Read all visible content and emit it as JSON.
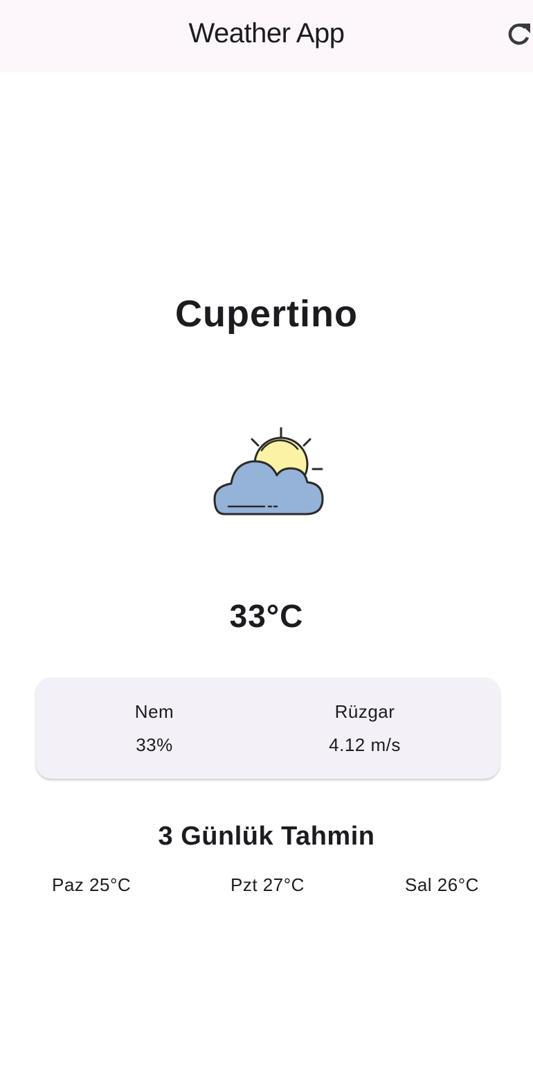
{
  "app_bar": {
    "title": "Weather App",
    "refresh_icon": "refresh-icon"
  },
  "weather": {
    "city": "Cupertino",
    "condition_icon": "partly-cloudy-icon",
    "temperature": "33°C"
  },
  "details": {
    "humidity_label": "Nem",
    "humidity_value": "33%",
    "wind_label": "Rüzgar",
    "wind_value": "4.12 m/s"
  },
  "forecast": {
    "title": "3 Günlük Tahmin",
    "days": [
      {
        "text": "Paz 25°C"
      },
      {
        "text": "Pzt 27°C"
      },
      {
        "text": "Sal 26°C"
      }
    ]
  },
  "colors": {
    "app_bar_bg": "#fdf7fc",
    "card_bg": "#f3f0f8",
    "cloud": "#95b2d8",
    "sun": "#fbf2a6",
    "outline": "#2a2a2a"
  }
}
